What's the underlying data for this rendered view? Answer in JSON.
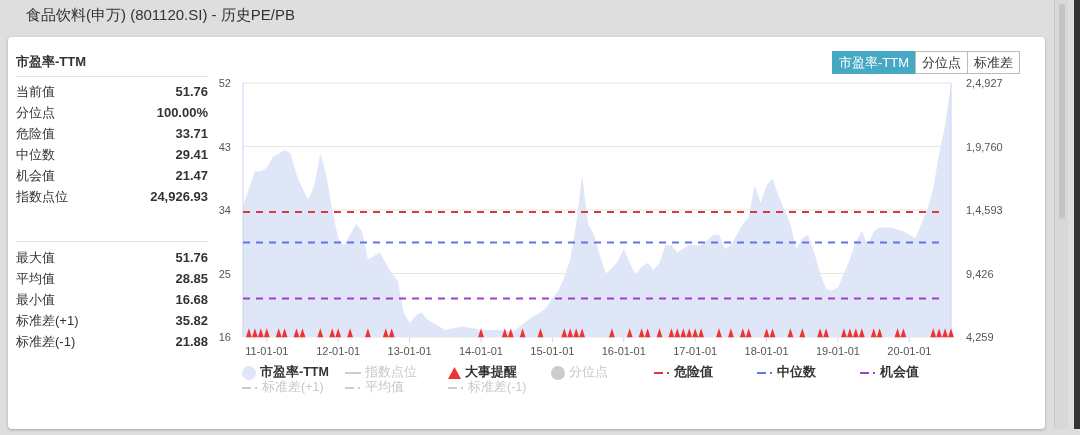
{
  "window": {
    "title": "食品饮料(申万) (801120.SI) - 历史PE/PB"
  },
  "panel": {
    "title": "市盈率-TTM",
    "current_stats": [
      {
        "label": "当前值",
        "value": "51.76"
      },
      {
        "label": "分位点",
        "value": "100.00%"
      },
      {
        "label": "危险值",
        "value": "33.71"
      },
      {
        "label": "中位数",
        "value": "29.41"
      },
      {
        "label": "机会值",
        "value": "21.47"
      },
      {
        "label": "指数点位",
        "value": "24,926.93"
      }
    ],
    "range_stats": [
      {
        "label": "最大值",
        "value": "51.76"
      },
      {
        "label": "平均值",
        "value": "28.85"
      },
      {
        "label": "最小值",
        "value": "16.68"
      },
      {
        "label": "标准差(+1)",
        "value": "35.82"
      },
      {
        "label": "标准差(-1)",
        "value": "21.88"
      }
    ]
  },
  "tabs": [
    {
      "label": "市盈率-TTM",
      "selected": true
    },
    {
      "label": "分位点",
      "selected": false
    },
    {
      "label": "标准差",
      "selected": false
    }
  ],
  "chart": {
    "chart_data": {
      "type": "area",
      "categories": [
        null,
        null,
        null,
        null,
        "11-01-01",
        null,
        null,
        null,
        null,
        null,
        null,
        null,
        null,
        null,
        null,
        null,
        "12-01-01",
        null,
        null,
        null,
        null,
        null,
        null,
        null,
        null,
        null,
        null,
        null,
        "13-01-01",
        null,
        null,
        null,
        null,
        null,
        null,
        null,
        null,
        null,
        null,
        null,
        "14-01-01",
        null,
        null,
        null,
        null,
        null,
        null,
        null,
        null,
        null,
        null,
        null,
        "15-01-01",
        null,
        null,
        null,
        null,
        null,
        null,
        null,
        null,
        null,
        null,
        null,
        "16-01-01",
        null,
        null,
        null,
        null,
        null,
        null,
        null,
        null,
        null,
        null,
        null,
        "17-01-01",
        null,
        null,
        null,
        null,
        null,
        null,
        null,
        null,
        null,
        null,
        null,
        "18-01-01",
        null,
        null,
        null,
        null,
        null,
        null,
        null,
        null,
        null,
        null,
        null,
        "19-01-01",
        null,
        null,
        null,
        null,
        null,
        null,
        null,
        null,
        null,
        null,
        null,
        "20-01-01",
        null,
        null,
        null,
        null,
        null,
        null,
        null
      ],
      "series": [
        {
          "name": "市盈率-TTM",
          "color": "#dfe6f7",
          "values": [
            34.5,
            37,
            39.5,
            39.5,
            40,
            41.5,
            42,
            42.5,
            42,
            39,
            37,
            35.5,
            37.5,
            42,
            39,
            34,
            30,
            29,
            30.5,
            32,
            31,
            27,
            27.5,
            28,
            26.5,
            25,
            24,
            19.5,
            18,
            19,
            19.5,
            18.5,
            18,
            17.5,
            17,
            17.2,
            17.3,
            17.5,
            17.3,
            17.2,
            17,
            17,
            17,
            17,
            16.9,
            16.8,
            17.1,
            17.8,
            18.5,
            19,
            19.5,
            20.2,
            21.5,
            22.5,
            24.5,
            27,
            32,
            39,
            32,
            30.5,
            27.5,
            25,
            25.8,
            26.7,
            28.5,
            26.5,
            24.8,
            26,
            26.5,
            25.5,
            26.5,
            29,
            29,
            28,
            28.5,
            29,
            29,
            29,
            29.7,
            30.5,
            30.5,
            28.5,
            29,
            30.5,
            32,
            33,
            37.5,
            35,
            37.5,
            38.5,
            36,
            34,
            32,
            28.5,
            30,
            30.5,
            28,
            25,
            22.8,
            22.6,
            23,
            25,
            27,
            29.5,
            31,
            29,
            31,
            31.5,
            31.5,
            31.5,
            31.2,
            31,
            30.5,
            30,
            32,
            34,
            37,
            42,
            46,
            51.8
          ]
        },
        {
          "name": "大事提醒",
          "type": "scatter",
          "color": "#ee3333",
          "values": [
            null,
            16.6,
            16.6,
            16.6,
            16.6,
            null,
            16.6,
            16.6,
            null,
            16.6,
            16.6,
            null,
            null,
            16.6,
            null,
            16.6,
            16.6,
            null,
            16.6,
            null,
            null,
            16.6,
            null,
            null,
            16.6,
            16.6,
            null,
            null,
            null,
            null,
            null,
            null,
            null,
            null,
            null,
            null,
            null,
            null,
            null,
            null,
            16.6,
            null,
            null,
            null,
            16.6,
            16.6,
            null,
            16.6,
            null,
            null,
            16.6,
            null,
            null,
            null,
            16.6,
            16.6,
            16.6,
            16.6,
            null,
            null,
            null,
            null,
            16.6,
            null,
            null,
            16.6,
            null,
            16.6,
            16.6,
            null,
            16.6,
            null,
            16.6,
            16.6,
            16.6,
            16.6,
            16.6,
            16.6,
            null,
            null,
            16.6,
            null,
            16.6,
            null,
            16.6,
            16.6,
            null,
            null,
            16.6,
            16.6,
            null,
            null,
            16.6,
            null,
            16.6,
            null,
            null,
            16.6,
            16.6,
            null,
            null,
            16.6,
            16.6,
            16.6,
            16.6,
            null,
            16.6,
            16.6,
            null,
            null,
            16.6,
            16.6,
            null,
            null,
            null,
            null,
            16.6,
            16.6,
            16.6,
            16.6
          ]
        }
      ],
      "ylim": [
        16,
        52
      ],
      "yticks": [
        16,
        25,
        34,
        43,
        52
      ],
      "grid": true,
      "ref_lines": [
        {
          "axis": "y",
          "value": 33.71,
          "color": "#d93a3a"
        },
        {
          "axis": "y",
          "value": 29.41,
          "color": "#6277e6"
        },
        {
          "axis": "y",
          "value": 21.47,
          "color": "#9a44c4"
        }
      ]
    },
    "right_axis_labels": [
      "2,4,927",
      "1,9,760",
      "1,4,593",
      "9,426",
      "4,259"
    ],
    "legend": [
      {
        "from_series": true,
        "kind": "circle",
        "disabled": false
      },
      {
        "label": "指数点位",
        "kind": "line",
        "color": "#cccccc",
        "disabled": true
      },
      {
        "from_series": true,
        "kind": "triangle",
        "disabled": false
      },
      {
        "label": "分位点",
        "kind": "circle",
        "color": "#cccccc",
        "disabled": true
      },
      {
        "label": "危险值",
        "kind": "dash",
        "color": "#d93a3a",
        "disabled": false
      },
      {
        "label": "中位数",
        "kind": "dash",
        "color": "#6277e6",
        "disabled": false
      },
      {
        "label": "机会值",
        "kind": "dash",
        "color": "#9a44c4",
        "disabled": false
      },
      {
        "label": "标准差(+1)",
        "kind": "dash",
        "color": "#cccccc",
        "disabled": true
      },
      {
        "label": "平均值",
        "kind": "dash",
        "color": "#cccccc",
        "disabled": true
      },
      {
        "label": "标准差(-1)",
        "kind": "dash",
        "color": "#cccccc",
        "disabled": true
      }
    ]
  }
}
